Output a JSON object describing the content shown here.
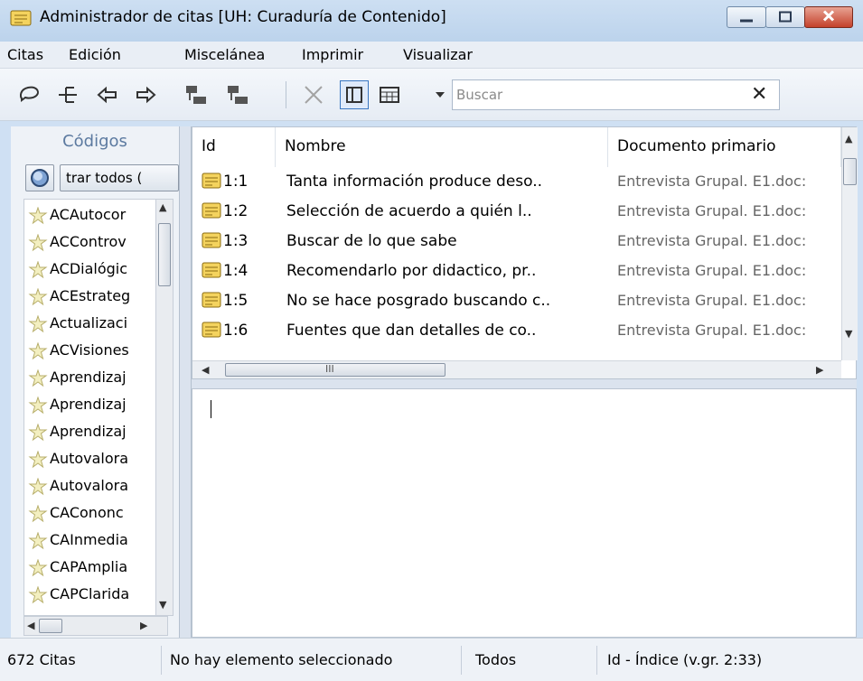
{
  "window": {
    "title": "Administrador de citas [UH: Curaduría de Contenido]",
    "accent": "#cfe0f3"
  },
  "menu": {
    "items": [
      "Citas",
      "Edición",
      "Miscelánea",
      "Imprimir",
      "Visualizar"
    ]
  },
  "toolbar": {
    "icons": [
      "comment-icon",
      "tree-icon",
      "arrow-left-icon",
      "arrow-right-icon",
      "list-collapse-icon",
      "list-expand-icon",
      "delete-icon",
      "layout-panel-icon",
      "grid-view-icon",
      "dropdown-arrow-icon"
    ],
    "search": {
      "placeholder": "Buscar",
      "value": ""
    },
    "clear_label": "✕"
  },
  "codes": {
    "header": "Códigos",
    "filter_label": "trar todos (",
    "items": [
      "ACAutocor",
      "ACControv",
      "ACDialógic",
      "ACEstrateg",
      "Actualizaci",
      "ACVisiones",
      "Aprendizaj",
      "Aprendizaj",
      "Aprendizaj",
      "Autovalora",
      "Autovalora",
      "CACononc",
      "CAInmedia",
      "CAPAmplia",
      "CAPClarida"
    ]
  },
  "quotations": {
    "columns": [
      "Id",
      "Nombre",
      "Documento primario"
    ],
    "rows": [
      {
        "id": "1:1",
        "name": "Tanta información produce deso..",
        "doc": "Entrevista Grupal. E1.doc:"
      },
      {
        "id": "1:2",
        "name": "Selección de acuerdo a quién l..",
        "doc": "Entrevista Grupal. E1.doc:"
      },
      {
        "id": "1:3",
        "name": "Buscar de lo que sabe",
        "doc": "Entrevista Grupal. E1.doc:"
      },
      {
        "id": "1:4",
        "name": "Recomendarlo por didactico, pr..",
        "doc": "Entrevista Grupal. E1.doc:"
      },
      {
        "id": "1:5",
        "name": "No se hace posgrado buscando c..",
        "doc": "Entrevista Grupal. E1.doc:"
      },
      {
        "id": "1:6",
        "name": "Fuentes que dan detalles de co..",
        "doc": "Entrevista Grupal. E1.doc:"
      }
    ],
    "hscroll_glyph": "III"
  },
  "status": {
    "count": "672 Citas",
    "selection": "No hay elemento seleccionado",
    "filter": "Todos",
    "sort": "Id - Índice (v.gr. 2:33)"
  }
}
